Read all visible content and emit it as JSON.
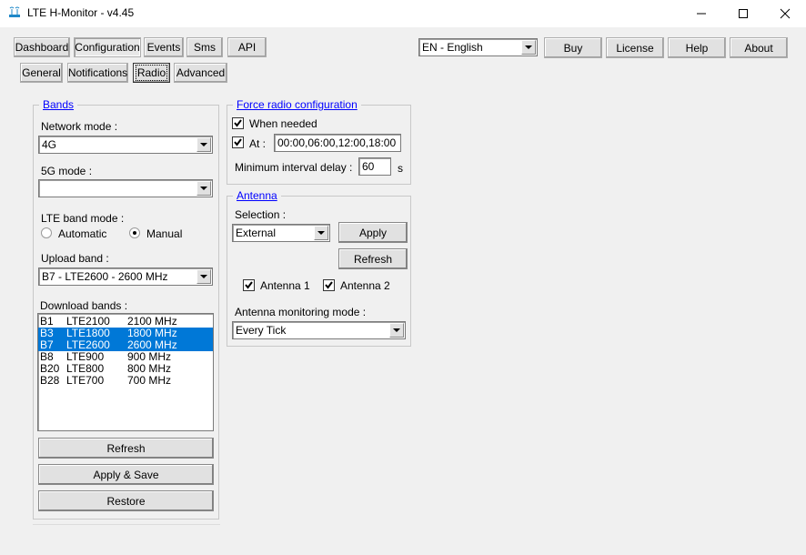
{
  "window": {
    "title": "LTE H-Monitor - v4.45",
    "icon": "antenna-router-icon",
    "controls": {
      "minimize": "minimize-icon",
      "maximize": "maximize-icon",
      "close": "close-icon"
    }
  },
  "main_tabs": [
    {
      "label": "Dashboard",
      "active": false
    },
    {
      "label": "Configuration",
      "active": true
    },
    {
      "label": "Events",
      "active": false
    },
    {
      "label": "Sms",
      "active": false
    },
    {
      "label": "API",
      "active": false
    }
  ],
  "sub_tabs": [
    {
      "label": "General",
      "active": false
    },
    {
      "label": "Notifications",
      "active": false
    },
    {
      "label": "Radio",
      "active": true
    },
    {
      "label": "Advanced",
      "active": false
    }
  ],
  "top_right": {
    "language": "EN - English",
    "buttons": [
      "Buy",
      "License",
      "Help",
      "About"
    ]
  },
  "bands": {
    "title": "Bands",
    "network_mode_label": "Network mode :",
    "network_mode_value": "4G",
    "fiveg_mode_label": "5G mode :",
    "fiveg_mode_value": "",
    "lte_band_mode_label": "LTE band mode :",
    "lte_band_mode_options": [
      "Automatic",
      "Manual"
    ],
    "lte_band_mode_selected": "Manual",
    "upload_band_label": "Upload band :",
    "upload_band_value": "B7 - LTE2600 - 2600 MHz",
    "download_bands_label": "Download bands :",
    "download_bands": [
      {
        "band": "B1",
        "name": "LTE2100",
        "freq": "2100 MHz",
        "selected": false
      },
      {
        "band": "B3",
        "name": "LTE1800",
        "freq": "1800 MHz",
        "selected": true
      },
      {
        "band": "B7",
        "name": "LTE2600",
        "freq": "2600 MHz",
        "selected": true
      },
      {
        "band": "B8",
        "name": "LTE900",
        "freq": "900 MHz",
        "selected": false
      },
      {
        "band": "B20",
        "name": "LTE800",
        "freq": "800 MHz",
        "selected": false
      },
      {
        "band": "B28",
        "name": "LTE700",
        "freq": "700 MHz",
        "selected": false
      }
    ],
    "refresh_label": "Refresh",
    "apply_save_label": "Apply & Save",
    "restore_label": "Restore"
  },
  "force_radio": {
    "title": "Force radio configuration",
    "when_needed_label": "When needed",
    "when_needed_checked": true,
    "at_label": "At :",
    "at_checked": true,
    "at_value": "00:00,06:00,12:00,18:00",
    "min_interval_label": "Minimum interval delay :",
    "min_interval_value": "60",
    "min_interval_unit": "s"
  },
  "antenna": {
    "title": "Antenna",
    "selection_label": "Selection :",
    "selection_value": "External",
    "apply_label": "Apply",
    "refresh_label": "Refresh",
    "antenna1_label": "Antenna 1",
    "antenna1_checked": true,
    "antenna2_label": "Antenna 2",
    "antenna2_checked": true,
    "monitoring_mode_label": "Antenna monitoring mode :",
    "monitoring_mode_value": "Every Tick"
  }
}
